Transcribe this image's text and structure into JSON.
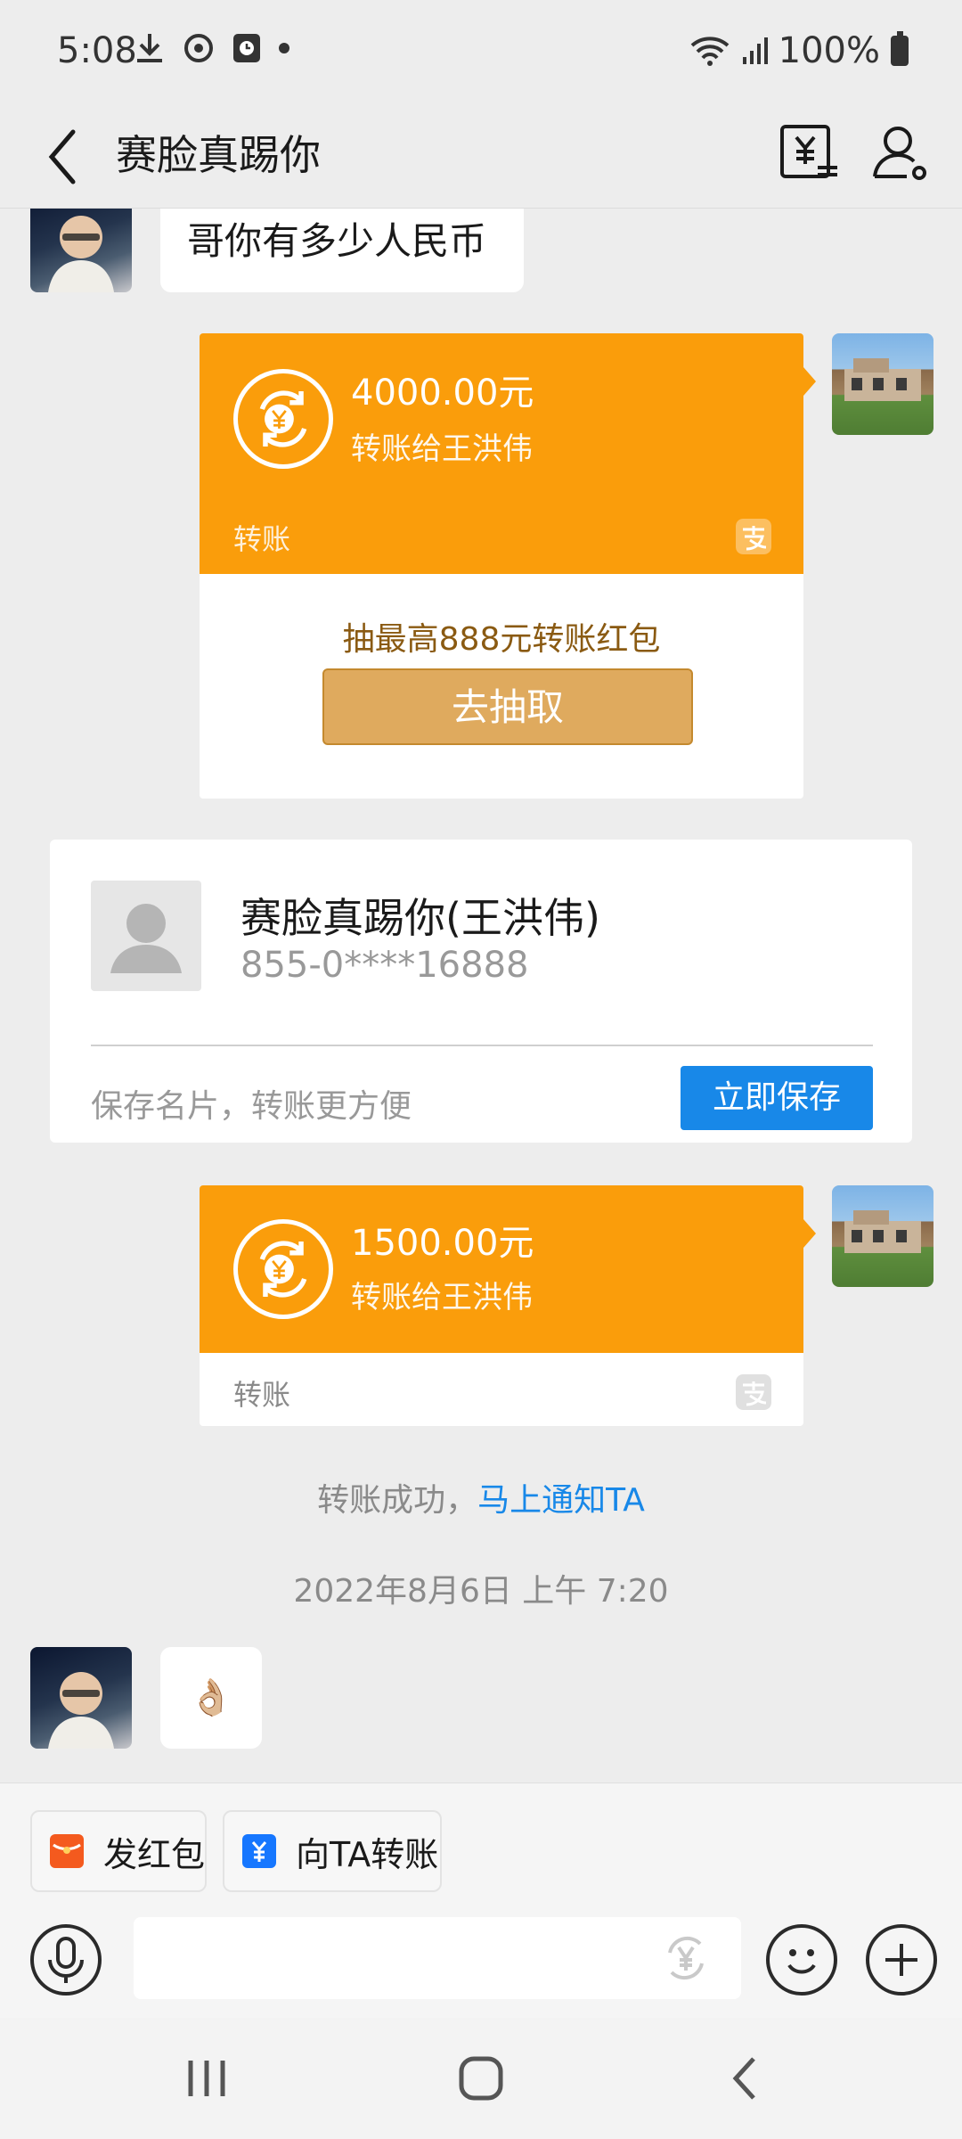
{
  "status_bar": {
    "time": "5:08",
    "battery": "100%"
  },
  "header": {
    "title": "赛脸真踢你"
  },
  "messages": {
    "incoming_text": "哥你有多少人民币",
    "transfer1": {
      "amount": "4000.00元",
      "desc": "转账给王洪伟",
      "label": "转账",
      "promo": "抽最高888元转账红包",
      "button": "去抽取"
    },
    "card": {
      "name": "赛脸真踢你(王洪伟)",
      "phone": "855-0****16888",
      "hint": "保存名片，转账更方便",
      "button": "立即保存"
    },
    "transfer2": {
      "amount": "1500.00元",
      "desc": "转账给王洪伟",
      "label": "转账"
    },
    "success_text": "转账成功，",
    "notify_link": "马上通知TA",
    "timestamp": "2022年8月6日 上午 7:20",
    "emoji": "👌🏼"
  },
  "quick_actions": [
    {
      "label": "发红包",
      "icon": "red-packet-icon",
      "color": "#f45a1e"
    },
    {
      "label": "向TA转账",
      "icon": "transfer-icon",
      "color": "#1677ff"
    }
  ],
  "input": {
    "placeholder": ""
  },
  "colors": {
    "transfer_orange": "#fa9d0b",
    "gold_button": "#dfaa5e",
    "blue": "#1888e8",
    "link": "#1888e8"
  }
}
